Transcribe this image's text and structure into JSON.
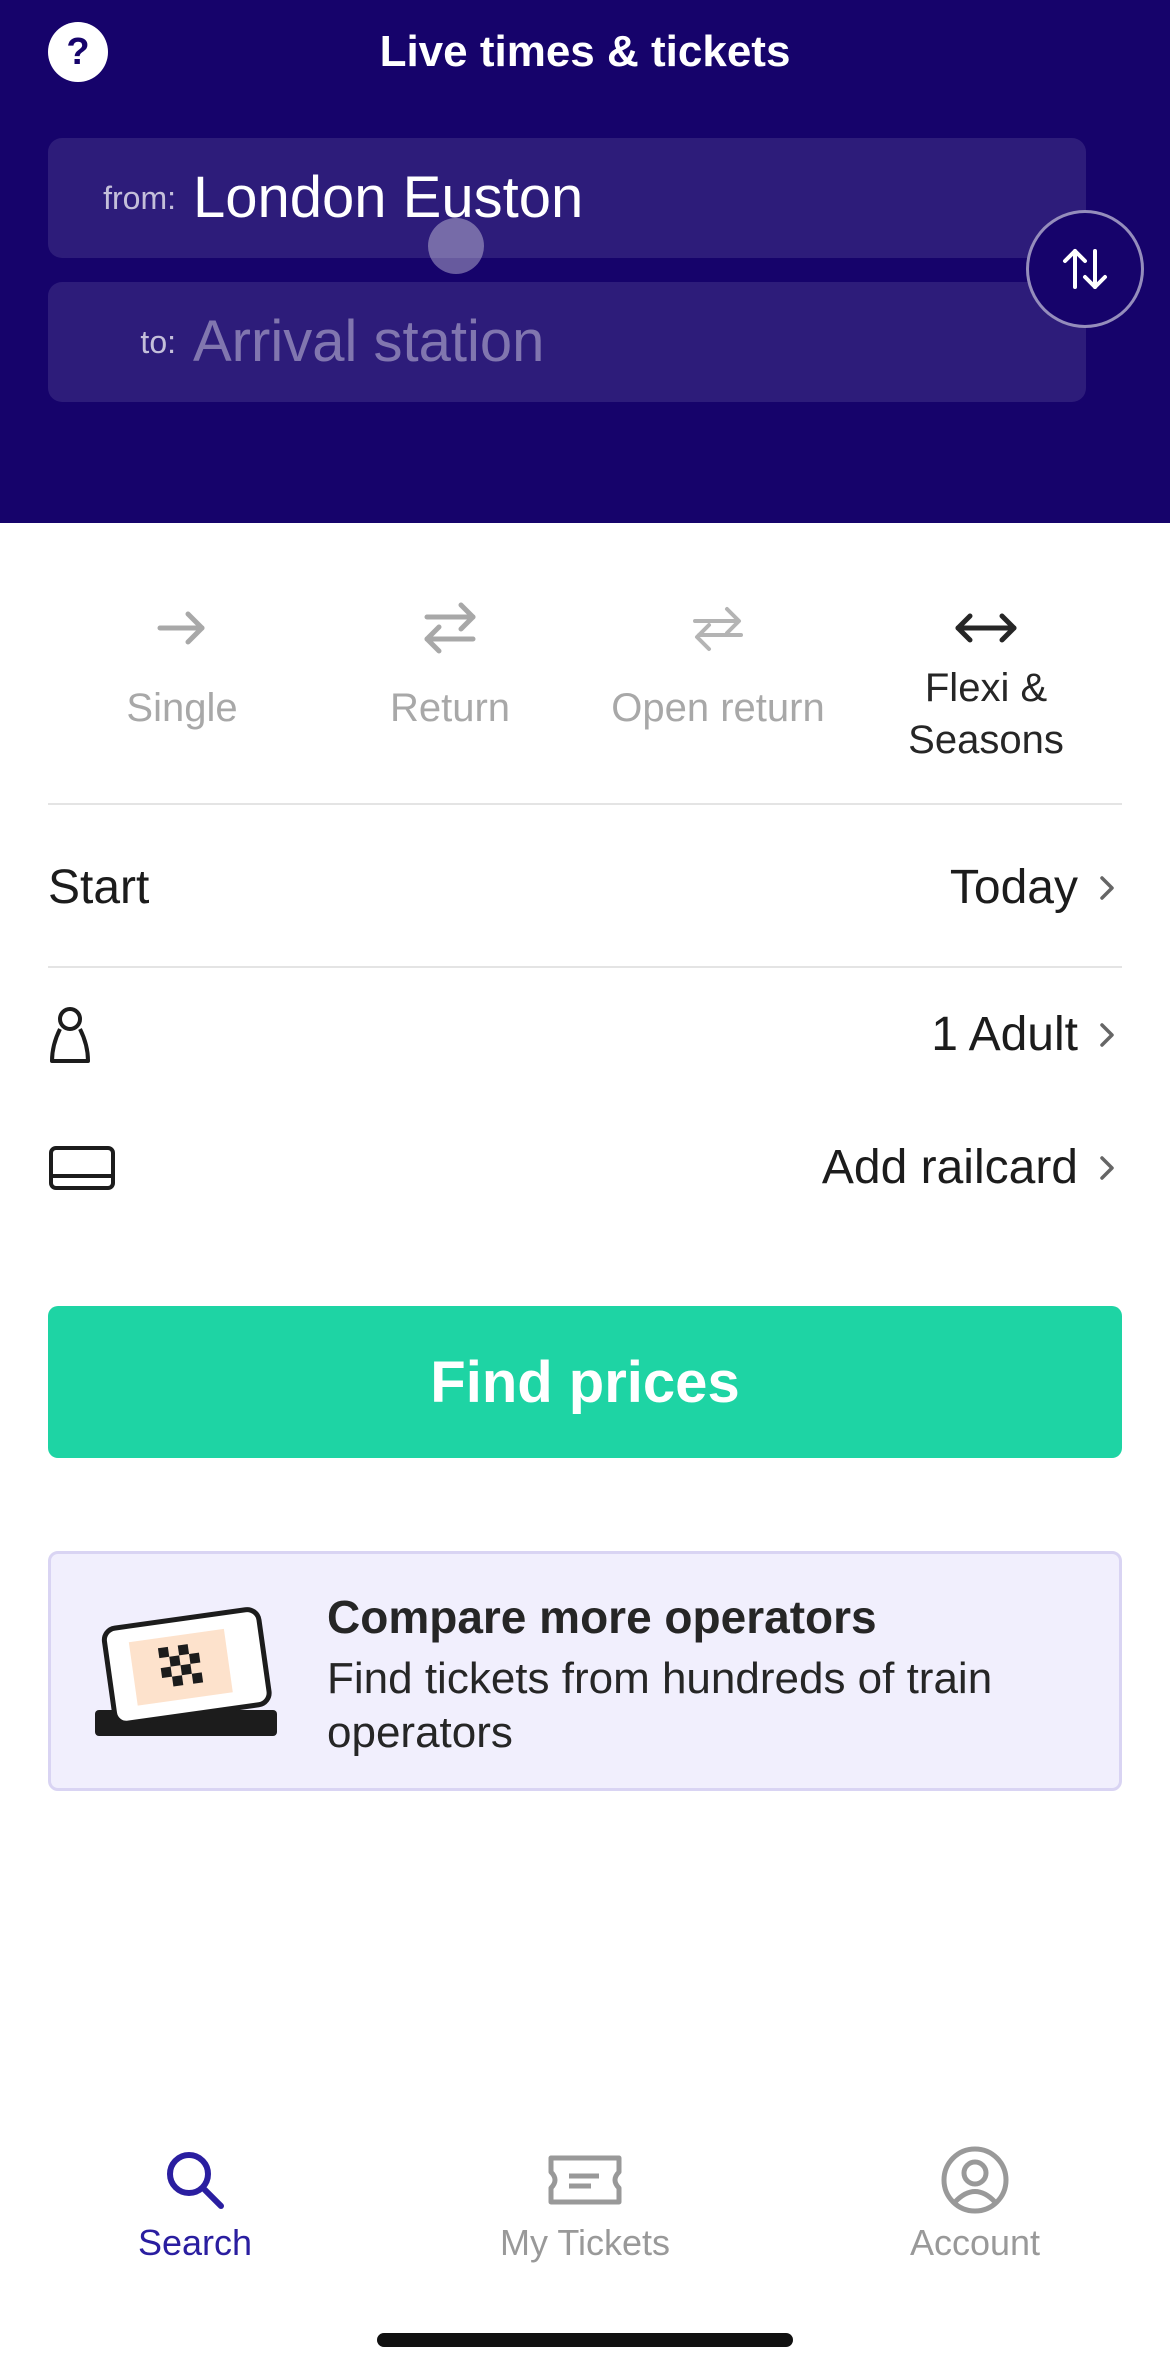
{
  "header": {
    "title": "Live times & tickets",
    "help_icon": "?"
  },
  "journey": {
    "from_label": "from:",
    "from_value": "London Euston",
    "to_label": "to:",
    "to_placeholder": "Arrival station"
  },
  "ticket_types": [
    {
      "label": "Single",
      "icon": "arrow-right-icon",
      "active": false
    },
    {
      "label": "Return",
      "icon": "return-arrows-icon",
      "active": false
    },
    {
      "label": "Open return",
      "icon": "open-return-arrows-icon",
      "active": false
    },
    {
      "label": "Flexi & Seasons",
      "icon": "double-arrow-icon",
      "active": true
    }
  ],
  "start": {
    "label": "Start",
    "value": "Today"
  },
  "passengers": {
    "value": "1 Adult"
  },
  "railcard": {
    "value": "Add railcard"
  },
  "find_button": "Find prices",
  "promo": {
    "title": "Compare more operators",
    "text": "Find tickets from hundreds of train operators"
  },
  "nav": [
    {
      "label": "Search",
      "icon": "search-icon",
      "active": true
    },
    {
      "label": "My Tickets",
      "icon": "ticket-icon",
      "active": false
    },
    {
      "label": "Account",
      "icon": "account-icon",
      "active": false
    }
  ],
  "colors": {
    "header_bg": "#16036b",
    "accent_green": "#1ed4a4",
    "active_nav": "#2a1ea0",
    "promo_bg": "#f1effd"
  }
}
